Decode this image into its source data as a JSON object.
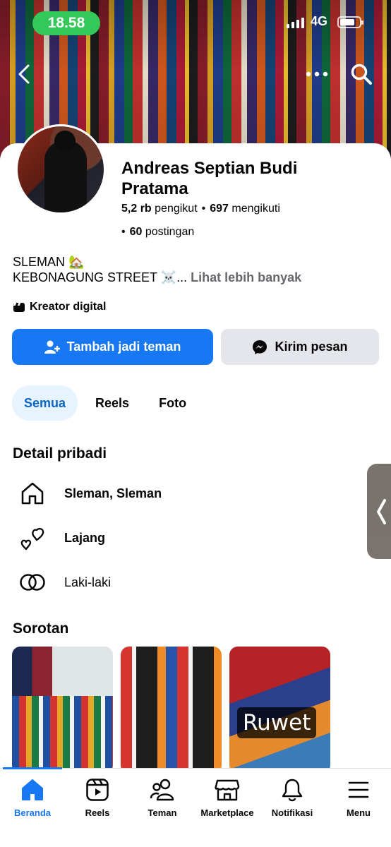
{
  "status_bar": {
    "time": "18.58",
    "network": "4G"
  },
  "colors": {
    "primary": "#1877f2",
    "status_green": "#34c759",
    "secondary_button": "#e4e6eb",
    "muted_text": "#65676b"
  },
  "profile": {
    "name": "Andreas Septian Budi Pratama",
    "followers_count": "5,2 rb",
    "followers_label": "pengikut",
    "following_count": "697",
    "following_label": "mengikuti",
    "posts_count": "60",
    "posts_label": "postingan",
    "bio_line1": "SLEMAN 🏡",
    "bio_line2": "KEBONAGUNG STREET ☠️...",
    "see_more": "Lihat lebih banyak",
    "tag": "Kreator digital"
  },
  "actions": {
    "add_friend": "Tambah jadi teman",
    "message": "Kirim pesan"
  },
  "tabs": [
    {
      "label": "Semua"
    },
    {
      "label": "Reels"
    },
    {
      "label": "Foto"
    }
  ],
  "details": {
    "title": "Detail pribadi",
    "items": [
      {
        "text": "Sleman, Sleman",
        "icon": "home-icon"
      },
      {
        "text": "Lajang",
        "icon": "hearts-icon"
      },
      {
        "text": "Laki-laki",
        "icon": "gender-rings-icon"
      }
    ]
  },
  "highlights": {
    "title": "Sorotan",
    "items": [
      {
        "label": ""
      },
      {
        "label": ""
      },
      {
        "label": "Ruwet"
      }
    ]
  },
  "bottom_nav": [
    {
      "label": "Beranda",
      "icon": "home-icon",
      "active": true
    },
    {
      "label": "Reels",
      "icon": "reels-icon"
    },
    {
      "label": "Teman",
      "icon": "friends-icon"
    },
    {
      "label": "Marketplace",
      "icon": "marketplace-icon"
    },
    {
      "label": "Notifikasi",
      "icon": "bell-icon"
    },
    {
      "label": "Menu",
      "icon": "menu-icon"
    }
  ]
}
